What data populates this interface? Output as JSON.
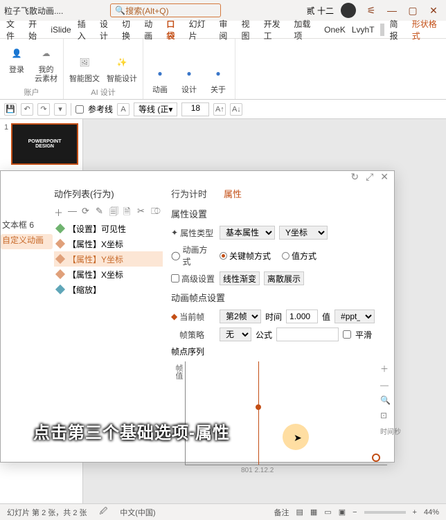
{
  "title": "粒子飞散动画....",
  "user_label": "贰 十二",
  "search_placeholder": "搜索(Alt+Q)",
  "menus": [
    "文件",
    "开始",
    "iSlide",
    "插入",
    "设计",
    "切换",
    "动画",
    "口袋",
    "幻灯片",
    "审阅",
    "视图",
    "开发工",
    "加载项",
    "OneK",
    "LvyhT",
    "简报",
    "形状格式"
  ],
  "menu_active_index": 7,
  "menu_last_red_index": 16,
  "ribbon": {
    "groups": [
      {
        "label": "账户",
        "items": [
          {
            "label": "登录"
          },
          {
            "label": "我的\n云素材"
          }
        ]
      },
      {
        "label": "AI 设计",
        "items": [
          {
            "label": "智能图文"
          },
          {
            "label": "智能设计"
          }
        ]
      },
      {
        "label": "",
        "items": [
          {
            "label": "动画"
          },
          {
            "label": "设计"
          },
          {
            "label": "关于"
          }
        ]
      }
    ]
  },
  "quickbar": {
    "guides": "参考线",
    "font": "等线 (正",
    "size": "18"
  },
  "slides": {
    "num": "1",
    "thumb_text": "POWERPOINT\nDESIGN"
  },
  "dialog": {
    "left_items": [
      "文本框 6",
      "自定义动画"
    ],
    "left_active": 1,
    "mid": {
      "title": "动作列表(行为)",
      "ops": [
        "＋",
        "—",
        "⟳",
        "✎",
        "🗐",
        "🗎",
        "✂",
        "⎄"
      ],
      "items": [
        {
          "label": "【设置】可见性",
          "color": "#6fb36f"
        },
        {
          "label": "【属性】X坐标",
          "color": "#e0a07a"
        },
        {
          "label": "【属性】Y坐标",
          "color": "#e0a07a",
          "selected": true
        },
        {
          "label": "【属性】X坐标",
          "color": "#e0a07a"
        },
        {
          "label": "【缩放】",
          "color": "#5fa6b8"
        }
      ]
    },
    "right": {
      "tabs": [
        "行为计时",
        "属性"
      ],
      "tab_active": 1,
      "section1_title": "属性设置",
      "type_label": "属性类型",
      "type_value": "基本属性",
      "type_value2": "Y坐标",
      "mode_label": "动画方式",
      "mode_opts": [
        "关键帧方式",
        "值方式"
      ],
      "adv_label": "高级设置",
      "adv_btns": [
        "线性渐变",
        "离散展示"
      ],
      "section2_title": "动画帧点设置",
      "cur_label": "当前帧",
      "cur_value": "第2帧",
      "time_label": "时间",
      "time_value": "1.000",
      "val_label": "值",
      "val_value": "#ppt_y",
      "strategy_label": "帧策略",
      "strategy_value": "无",
      "formula_label": "公式",
      "smooth_label": "平滑",
      "seq_title": "帧点序列",
      "y_axis": "帧值",
      "x_axis": "时间秒",
      "ticks": "801 2.12.2"
    }
  },
  "subtitle": "点击第三个基础选项-属性",
  "status": {
    "left": "幻灯片 第 2 张，共 2 张",
    "lang": "中文(中国)",
    "notes": "备注",
    "zoom": "44%"
  }
}
